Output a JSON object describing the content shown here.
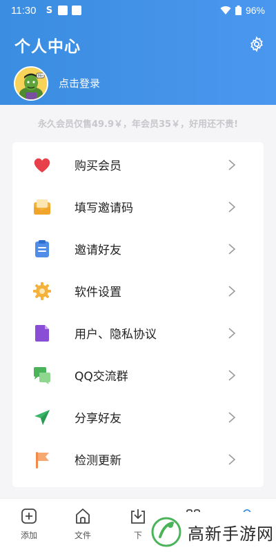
{
  "status": {
    "time": "11:30",
    "battery": "96%"
  },
  "header": {
    "title": "个人中心",
    "login_text": "点击登录",
    "avatar_text": "Me"
  },
  "promo": "永久会员仅售49.9￥，年会员35￥，好用还不贵!",
  "menu": [
    {
      "label": "购买会员",
      "icon": "heart-icon",
      "color": "#e8404a"
    },
    {
      "label": "填写邀请码",
      "icon": "envelope-icon",
      "color": "#f4b23c"
    },
    {
      "label": "邀请好友",
      "icon": "clipboard-icon",
      "color": "#4f8de8"
    },
    {
      "label": "软件设置",
      "icon": "gear-icon",
      "color": "#f4b23c"
    },
    {
      "label": "用户、隐私协议",
      "icon": "document-icon",
      "color": "#8a4ed6"
    },
    {
      "label": "QQ交流群",
      "icon": "chat-icon",
      "color": "#4bb35a"
    },
    {
      "label": "分享好友",
      "icon": "send-icon",
      "color": "#3bb56a"
    },
    {
      "label": "检测更新",
      "icon": "flag-icon",
      "color": "#f28a4a"
    }
  ],
  "bottom_nav": [
    {
      "label": "添加",
      "icon": "add-icon"
    },
    {
      "label": "文件",
      "icon": "home-icon"
    },
    {
      "label": "下",
      "icon": "download-icon"
    },
    {
      "label": "",
      "icon": "apps-icon"
    },
    {
      "label": "",
      "icon": "profile-icon"
    }
  ],
  "watermark": {
    "text": "高新手游网"
  }
}
